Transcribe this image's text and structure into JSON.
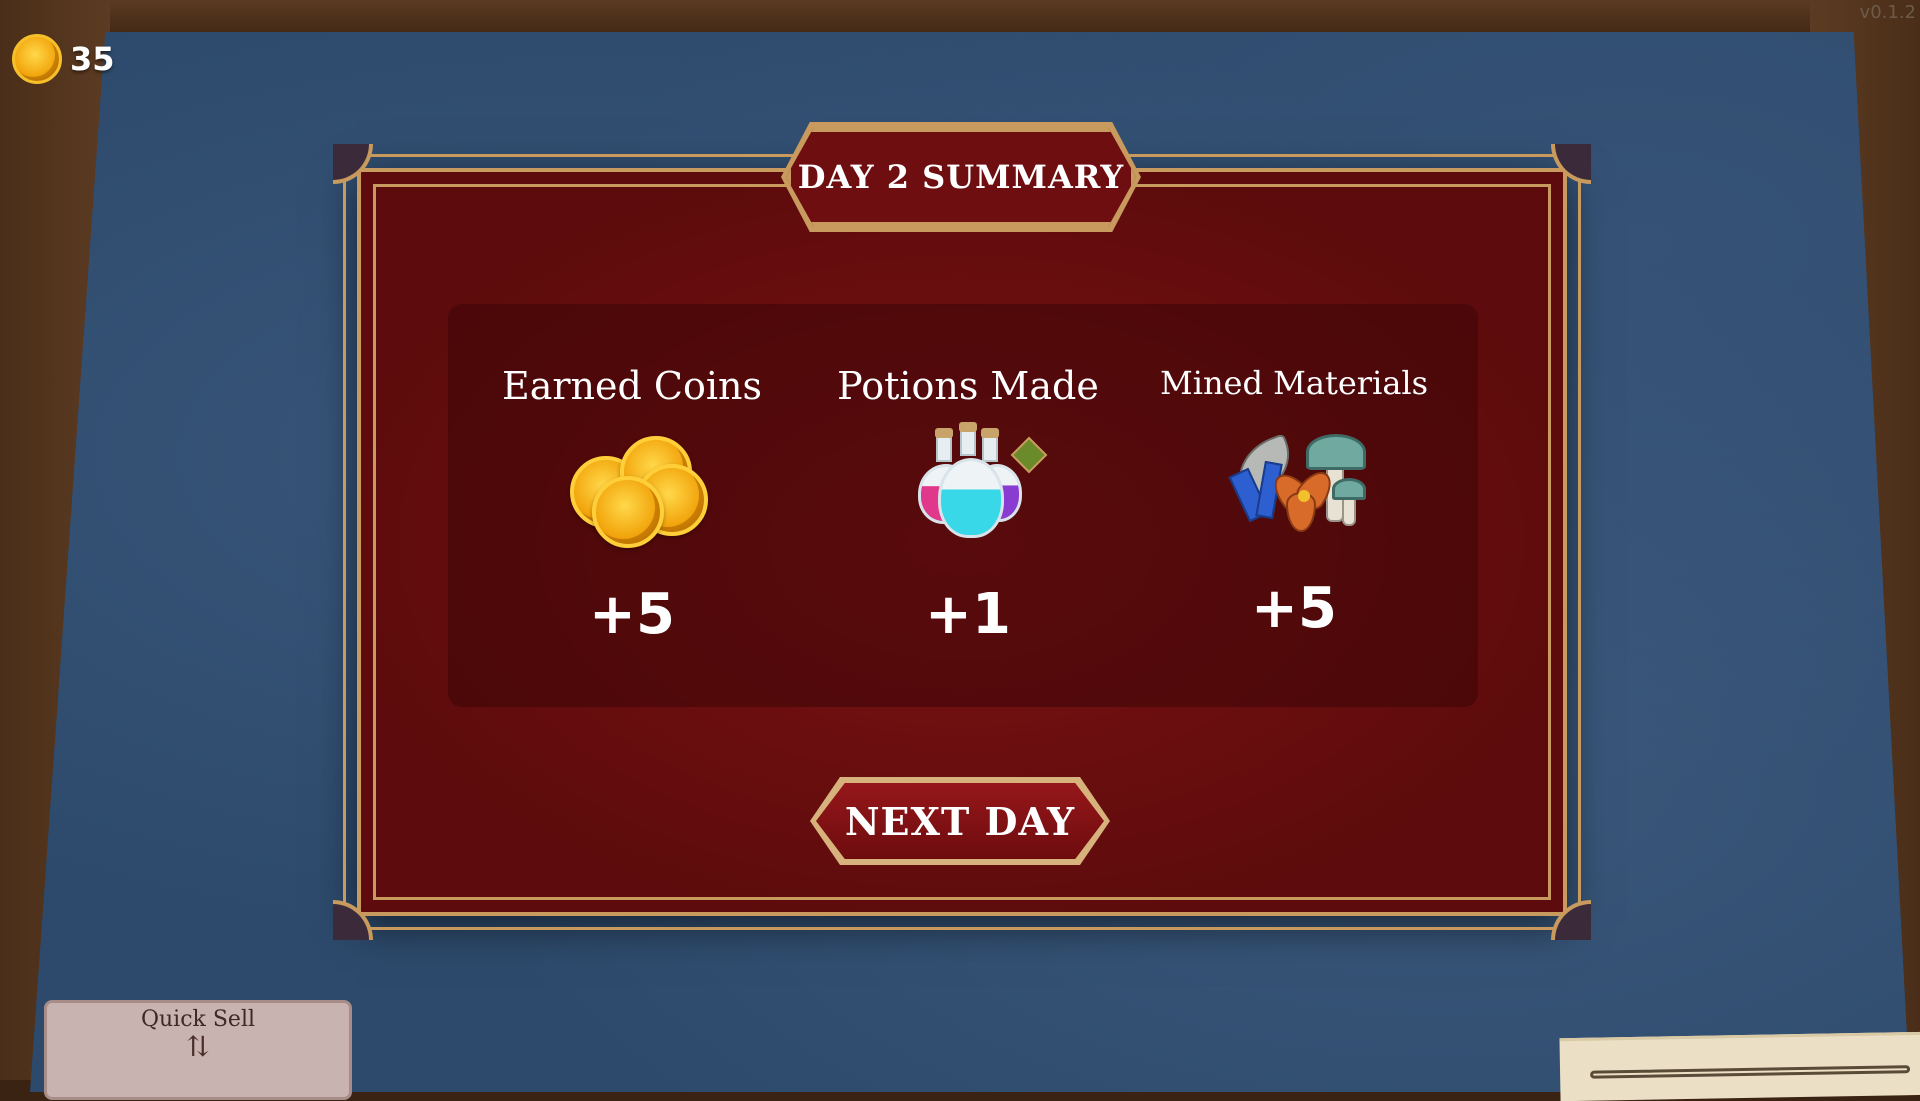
{
  "version": "v0.1.2",
  "hud": {
    "coins": "35",
    "coin_icon": "coin-icon"
  },
  "summary": {
    "title": "DAY 2 SUMMARY",
    "stats": [
      {
        "label": "Earned Coins",
        "icon": "coin-pile-icon",
        "value": "+5"
      },
      {
        "label": "Potions Made",
        "icon": "potion-bottles-icon",
        "value": "+1"
      },
      {
        "label": "Mined Materials",
        "icon": "materials-bundle-icon",
        "value": "+5"
      }
    ],
    "next_button": "NEXT DAY"
  },
  "quick_sell": {
    "label": "Quick Sell",
    "icon": "sell-arrows-icon"
  },
  "colors": {
    "panel": "#6e0e10",
    "frame": "#c89a5e",
    "cloth": "#2d4a6c",
    "coin": "#f2a50c"
  }
}
